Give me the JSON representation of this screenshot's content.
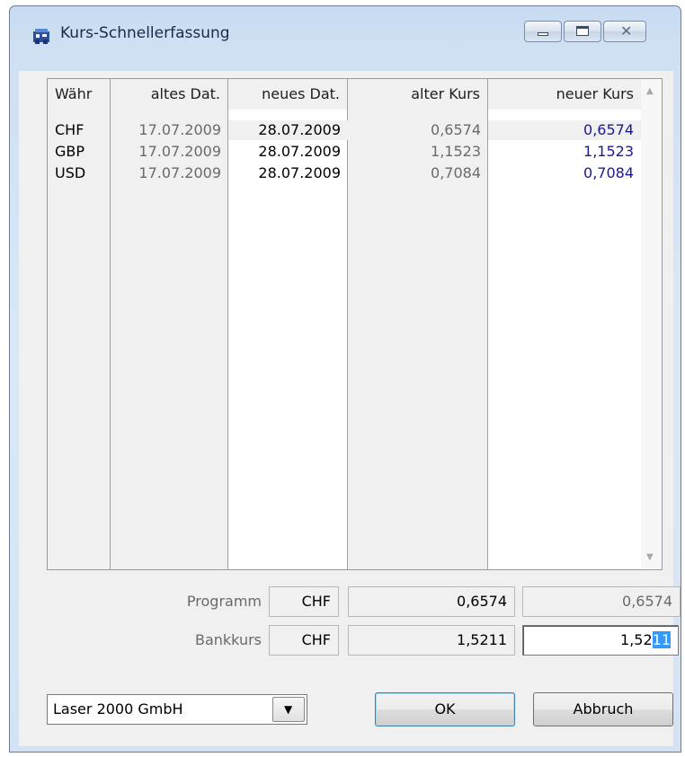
{
  "window": {
    "title": "Kurs-Schnellerfassung",
    "caption_buttons": [
      "minimize-icon",
      "maximize-icon",
      "close-icon"
    ]
  },
  "grid": {
    "headers": [
      "Währ",
      "altes Dat.",
      "neues Dat.",
      "alter Kurs",
      "neuer Kurs"
    ],
    "rows": [
      {
        "currency": "CHF",
        "old_date": "17.07.2009",
        "new_date": "28.07.2009",
        "old_rate": "0,6574",
        "new_rate": "0,6574"
      },
      {
        "currency": "GBP",
        "old_date": "17.07.2009",
        "new_date": "28.07.2009",
        "old_rate": "1,1523",
        "new_rate": "1,1523"
      },
      {
        "currency": "USD",
        "old_date": "17.07.2009",
        "new_date": "28.07.2009",
        "old_rate": "0,7084",
        "new_rate": "0,7084"
      }
    ]
  },
  "program_row": {
    "label": "Programm",
    "currency": "CHF",
    "rate": "0,6574",
    "rate2": "0,6574"
  },
  "bank_row": {
    "label": "Bankkurs",
    "currency": "CHF",
    "rate": "1,5211",
    "input_value_prefix": "1,52",
    "input_value_selected": "11"
  },
  "company_combo": {
    "value": "Laser 2000 GmbH"
  },
  "buttons": {
    "ok": "OK",
    "cancel": "Abbruch"
  },
  "colors": {
    "selection": "#3399ff",
    "new_rate_text": "#1a1a8c"
  }
}
